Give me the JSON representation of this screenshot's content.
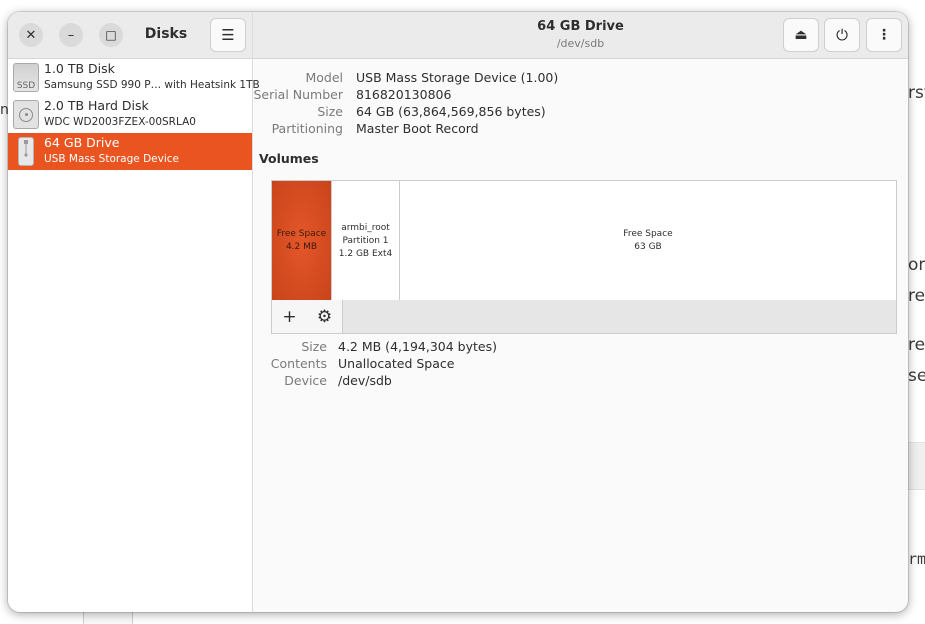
{
  "background": {
    "fragments": [
      "rst",
      "on",
      "re",
      "re",
      "se",
      "rm"
    ]
  },
  "sidebar": {
    "title": "Disks",
    "window_buttons": {
      "close": "✕",
      "minimize": "–",
      "maximize": "□"
    },
    "menu_icon": "☰",
    "drives": [
      {
        "name": "1.0 TB Disk",
        "subtitle": "Samsung SSD 990 P… with Heatsink 1TB",
        "icon": "ssd-icon",
        "icon_text": "SSD",
        "selected": false
      },
      {
        "name": "2.0 TB Hard Disk",
        "subtitle": "WDC WD2003FZEX-00SRLA0",
        "icon": "hard-disk-icon",
        "selected": false
      },
      {
        "name": "64 GB Drive",
        "subtitle": "USB Mass Storage Device",
        "icon": "usb-drive-icon",
        "selected": true
      }
    ]
  },
  "header": {
    "title": "64 GB Drive",
    "subtitle": "/dev/sdb",
    "eject_icon": "⏏",
    "power_icon": "⏻",
    "more_icon": "⋮"
  },
  "drive_properties": [
    {
      "label": "Model",
      "value": "USB Mass Storage Device (1.00)"
    },
    {
      "label": "Serial Number",
      "value": "816820130806"
    },
    {
      "label": "Size",
      "value": "64 GB (63,864,569,856 bytes)"
    },
    {
      "label": "Partitioning",
      "value": "Master Boot Record"
    }
  ],
  "volumes": {
    "heading": "Volumes",
    "segments": [
      {
        "lines": [
          "Free Space",
          "4.2 MB"
        ],
        "selected": true
      },
      {
        "lines": [
          "armbi_root",
          "Partition 1",
          "1.2 GB Ext4"
        ],
        "selected": false
      },
      {
        "lines": [
          "Free Space",
          "63 GB"
        ],
        "selected": false
      }
    ],
    "toolbar": {
      "add_icon": "+",
      "settings_icon": "⚙"
    }
  },
  "volume_properties": [
    {
      "label": "Size",
      "value": "4.2 MB (4,194,304 bytes)"
    },
    {
      "label": "Contents",
      "value": "Unallocated Space"
    },
    {
      "label": "Device",
      "value": "/dev/sdb"
    }
  ],
  "colors": {
    "accent": "#e95420",
    "header_bg": "#ebebeb",
    "label": "#7a7a7a",
    "text": "#2e2e2e"
  }
}
